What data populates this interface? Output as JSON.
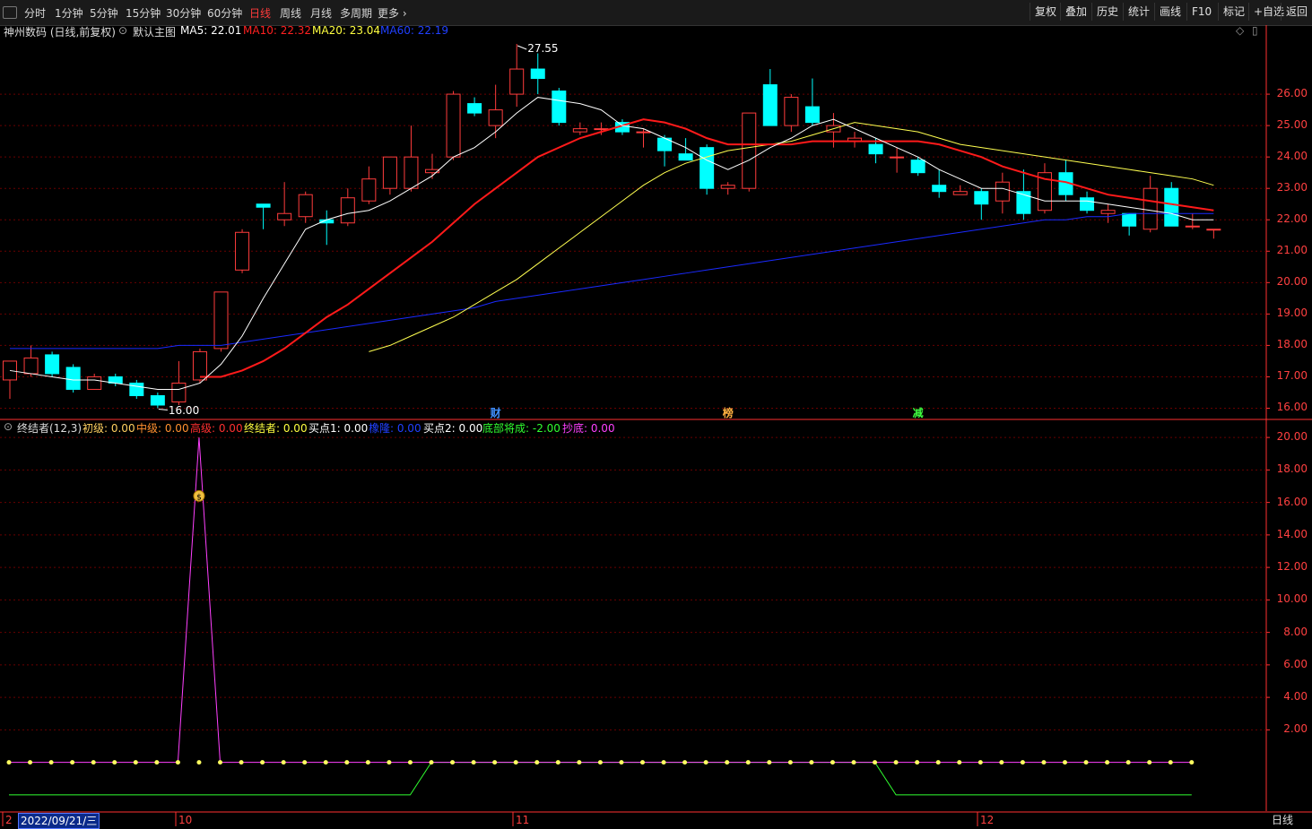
{
  "toolbar": {
    "periods": [
      "分时",
      "1分钟",
      "5分钟",
      "15分钟",
      "30分钟",
      "60分钟",
      "日线",
      "周线",
      "月线",
      "多周期",
      "更多 ›"
    ],
    "active_period": "日线",
    "right_buttons": [
      "复权",
      "叠加",
      "历史",
      "统计",
      "画线",
      "F10",
      "标记",
      "+自选",
      "返回"
    ]
  },
  "main_header": {
    "stock": "神州数码 (日线,前复权)",
    "template": "默认主图",
    "ma5": {
      "label": "MA5:",
      "value": "22.01",
      "color": "#ffffff"
    },
    "ma10": {
      "label": "MA10:",
      "value": "22.32",
      "color": "#ff2020"
    },
    "ma20": {
      "label": "MA20:",
      "value": "23.04",
      "color": "#ffff40"
    },
    "ma60": {
      "label": "MA60:",
      "value": "22.19",
      "color": "#2030ff"
    }
  },
  "sub_header": {
    "name": "终结者(12,3)",
    "items": [
      {
        "label": "初级:",
        "value": "0.00",
        "color": "#ffd060"
      },
      {
        "label": "中级:",
        "value": "0.00",
        "color": "#ff9030"
      },
      {
        "label": "高级:",
        "value": "0.00",
        "color": "#ff3030"
      },
      {
        "label": "终结者:",
        "value": "0.00",
        "color": "#ffff40"
      },
      {
        "label": "买点1:",
        "value": "0.00",
        "color": "#ffffff"
      },
      {
        "label": "橡隆:",
        "value": "0.00",
        "color": "#2040ff"
      },
      {
        "label": "买点2:",
        "value": "0.00",
        "color": "#ffffff"
      },
      {
        "label": "底部将成:",
        "value": "-2.00",
        "color": "#30ff30"
      },
      {
        "label": "抄底:",
        "value": "0.00",
        "color": "#ff40ff"
      }
    ]
  },
  "price_labels": {
    "high": "27.55",
    "low": "16.00"
  },
  "event_marks": [
    {
      "text": "财",
      "color": "#4090ff",
      "index": 23
    },
    {
      "text": "榜",
      "color": "#ffb040",
      "index": 34
    },
    {
      "text": "减",
      "color": "#40ff40",
      "index": 43
    }
  ],
  "x_axis": {
    "date_cursor": "2022/09/21/三",
    "month_labels": [
      "2",
      "10",
      "11",
      "12"
    ],
    "period_label": "日线"
  },
  "colors": {
    "up": "#ff3c3c",
    "down": "#00ffff",
    "ma5": "#ffffff",
    "ma10": "#ff1a1a",
    "ma20": "#ffff50",
    "ma60": "#1a2aff",
    "indicator": "#ff40ff",
    "bottom": "#30ff30",
    "axis": "#ff3030"
  },
  "chart_data": [
    {
      "type": "candlestick",
      "title": "神州数码 (日线,前复权)",
      "y_ticks": [
        16.0,
        17.0,
        18.0,
        19.0,
        20.0,
        21.0,
        22.0,
        23.0,
        24.0,
        25.0,
        26.0
      ],
      "ylim": [
        15.7,
        27.8
      ],
      "candles": [
        {
          "o": 16.9,
          "h": 17.5,
          "l": 16.3,
          "c": 17.5
        },
        {
          "o": 17.1,
          "h": 18.0,
          "l": 17.0,
          "c": 17.6
        },
        {
          "o": 17.7,
          "h": 17.8,
          "l": 17.0,
          "c": 17.1
        },
        {
          "o": 17.3,
          "h": 17.4,
          "l": 16.5,
          "c": 16.6
        },
        {
          "o": 16.6,
          "h": 17.1,
          "l": 16.6,
          "c": 17.0
        },
        {
          "o": 17.0,
          "h": 17.1,
          "l": 16.7,
          "c": 16.8
        },
        {
          "o": 16.8,
          "h": 16.9,
          "l": 16.3,
          "c": 16.4
        },
        {
          "o": 16.4,
          "h": 16.5,
          "l": 16.0,
          "c": 16.1
        },
        {
          "o": 16.2,
          "h": 17.5,
          "l": 16.1,
          "c": 16.8
        },
        {
          "o": 16.9,
          "h": 17.9,
          "l": 16.8,
          "c": 17.8
        },
        {
          "o": 17.9,
          "h": 19.7,
          "l": 17.8,
          "c": 19.7
        },
        {
          "o": 20.4,
          "h": 21.7,
          "l": 20.3,
          "c": 21.6
        },
        {
          "o": 22.5,
          "h": 22.5,
          "l": 21.7,
          "c": 22.4
        },
        {
          "o": 22.0,
          "h": 23.2,
          "l": 21.8,
          "c": 22.2
        },
        {
          "o": 22.1,
          "h": 22.9,
          "l": 21.9,
          "c": 22.8
        },
        {
          "o": 22.0,
          "h": 22.3,
          "l": 21.2,
          "c": 21.9
        },
        {
          "o": 21.9,
          "h": 23.0,
          "l": 21.8,
          "c": 22.7
        },
        {
          "o": 22.6,
          "h": 23.7,
          "l": 22.5,
          "c": 23.3
        },
        {
          "o": 23.0,
          "h": 24.0,
          "l": 22.8,
          "c": 24.0
        },
        {
          "o": 23.0,
          "h": 25.0,
          "l": 22.9,
          "c": 24.0
        },
        {
          "o": 23.5,
          "h": 24.1,
          "l": 23.3,
          "c": 23.6
        },
        {
          "o": 24.0,
          "h": 26.1,
          "l": 23.9,
          "c": 26.0
        },
        {
          "o": 25.7,
          "h": 25.9,
          "l": 25.3,
          "c": 25.4
        },
        {
          "o": 25.0,
          "h": 26.3,
          "l": 24.6,
          "c": 25.5
        },
        {
          "o": 26.0,
          "h": 27.6,
          "l": 25.6,
          "c": 26.8
        },
        {
          "o": 26.8,
          "h": 27.3,
          "l": 26.0,
          "c": 26.5
        },
        {
          "o": 26.1,
          "h": 26.2,
          "l": 25.0,
          "c": 25.1
        },
        {
          "o": 24.8,
          "h": 25.1,
          "l": 24.7,
          "c": 24.9
        },
        {
          "o": 24.9,
          "h": 25.1,
          "l": 24.7,
          "c": 24.9
        },
        {
          "o": 25.1,
          "h": 25.2,
          "l": 24.7,
          "c": 24.8
        },
        {
          "o": 24.8,
          "h": 24.9,
          "l": 24.3,
          "c": 24.8
        },
        {
          "o": 24.6,
          "h": 24.7,
          "l": 23.7,
          "c": 24.2
        },
        {
          "o": 24.1,
          "h": 24.6,
          "l": 23.9,
          "c": 23.9
        },
        {
          "o": 24.3,
          "h": 24.4,
          "l": 22.8,
          "c": 23.0
        },
        {
          "o": 23.0,
          "h": 23.2,
          "l": 22.8,
          "c": 23.1
        },
        {
          "o": 23.0,
          "h": 25.4,
          "l": 22.9,
          "c": 25.4
        },
        {
          "o": 26.3,
          "h": 26.8,
          "l": 25.0,
          "c": 25.0
        },
        {
          "o": 25.0,
          "h": 26.0,
          "l": 24.8,
          "c": 25.9
        },
        {
          "o": 25.6,
          "h": 26.5,
          "l": 25.0,
          "c": 25.1
        },
        {
          "o": 24.8,
          "h": 25.4,
          "l": 24.3,
          "c": 25.0
        },
        {
          "o": 24.5,
          "h": 24.8,
          "l": 24.3,
          "c": 24.6
        },
        {
          "o": 24.4,
          "h": 24.6,
          "l": 23.8,
          "c": 24.1
        },
        {
          "o": 24.0,
          "h": 24.3,
          "l": 23.5,
          "c": 24.0
        },
        {
          "o": 23.9,
          "h": 24.0,
          "l": 23.4,
          "c": 23.5
        },
        {
          "o": 23.1,
          "h": 23.6,
          "l": 22.7,
          "c": 22.9
        },
        {
          "o": 22.8,
          "h": 23.1,
          "l": 22.8,
          "c": 22.9
        },
        {
          "o": 22.9,
          "h": 23.0,
          "l": 22.0,
          "c": 22.5
        },
        {
          "o": 22.6,
          "h": 23.5,
          "l": 22.2,
          "c": 23.2
        },
        {
          "o": 22.9,
          "h": 23.6,
          "l": 22.0,
          "c": 22.2
        },
        {
          "o": 22.3,
          "h": 23.8,
          "l": 22.2,
          "c": 23.5
        },
        {
          "o": 23.5,
          "h": 23.9,
          "l": 22.6,
          "c": 22.8
        },
        {
          "o": 22.7,
          "h": 22.9,
          "l": 22.2,
          "c": 22.3
        },
        {
          "o": 22.2,
          "h": 22.5,
          "l": 21.9,
          "c": 22.3
        },
        {
          "o": 22.2,
          "h": 22.2,
          "l": 21.5,
          "c": 21.8
        },
        {
          "o": 21.7,
          "h": 23.4,
          "l": 21.6,
          "c": 23.0
        },
        {
          "o": 23.0,
          "h": 23.2,
          "l": 21.8,
          "c": 21.8
        },
        {
          "o": 21.8,
          "h": 22.2,
          "l": 21.7,
          "c": 21.8
        },
        {
          "o": 21.7,
          "h": 21.7,
          "l": 21.4,
          "c": 21.7
        }
      ],
      "ma5": [
        17.2,
        17.1,
        17.0,
        16.9,
        16.9,
        16.8,
        16.7,
        16.6,
        16.6,
        16.8,
        17.4,
        18.3,
        19.5,
        20.6,
        21.7,
        22.0,
        22.2,
        22.3,
        22.6,
        23.0,
        23.4,
        24.0,
        24.3,
        24.8,
        25.4,
        25.9,
        25.8,
        25.7,
        25.5,
        25.0,
        24.9,
        24.6,
        24.3,
        23.9,
        23.6,
        23.9,
        24.3,
        24.6,
        25.0,
        25.2,
        24.9,
        24.6,
        24.3,
        24.0,
        23.6,
        23.3,
        23.0,
        23.0,
        22.8,
        22.6,
        22.6,
        22.6,
        22.5,
        22.4,
        22.3,
        22.2,
        22.0,
        22.0
      ],
      "ma10": [
        null,
        null,
        null,
        null,
        null,
        null,
        null,
        null,
        null,
        17.0,
        17.0,
        17.2,
        17.5,
        17.9,
        18.4,
        18.9,
        19.3,
        19.8,
        20.3,
        20.8,
        21.3,
        21.9,
        22.5,
        23.0,
        23.5,
        24.0,
        24.3,
        24.6,
        24.8,
        25.0,
        25.2,
        25.1,
        24.9,
        24.6,
        24.4,
        24.4,
        24.4,
        24.4,
        24.5,
        24.5,
        24.5,
        24.5,
        24.5,
        24.5,
        24.4,
        24.2,
        24.0,
        23.7,
        23.5,
        23.3,
        23.2,
        23.0,
        22.8,
        22.7,
        22.6,
        22.5,
        22.4,
        22.3
      ],
      "ma20": [
        null,
        null,
        null,
        null,
        null,
        null,
        null,
        null,
        null,
        null,
        null,
        null,
        null,
        null,
        null,
        null,
        null,
        17.8,
        18.0,
        18.3,
        18.6,
        18.9,
        19.3,
        19.7,
        20.1,
        20.6,
        21.1,
        21.6,
        22.1,
        22.6,
        23.1,
        23.5,
        23.8,
        24.0,
        24.2,
        24.3,
        24.4,
        24.5,
        24.7,
        24.9,
        25.1,
        25.0,
        24.9,
        24.8,
        24.6,
        24.4,
        24.3,
        24.2,
        24.1,
        24.0,
        23.9,
        23.8,
        23.7,
        23.6,
        23.5,
        23.4,
        23.3,
        23.1
      ],
      "ma60": [
        17.9,
        17.9,
        17.9,
        17.9,
        17.9,
        17.9,
        17.9,
        17.9,
        18.0,
        18.0,
        18.0,
        18.1,
        18.2,
        18.3,
        18.4,
        18.5,
        18.6,
        18.7,
        18.8,
        18.9,
        19.0,
        19.1,
        19.2,
        19.4,
        19.5,
        19.6,
        19.7,
        19.8,
        19.9,
        20.0,
        20.1,
        20.2,
        20.3,
        20.4,
        20.5,
        20.6,
        20.7,
        20.8,
        20.9,
        21.0,
        21.1,
        21.2,
        21.3,
        21.4,
        21.5,
        21.6,
        21.7,
        21.8,
        21.9,
        22.0,
        22.0,
        22.1,
        22.1,
        22.2,
        22.2,
        22.2,
        22.2,
        22.2
      ]
    },
    {
      "type": "line",
      "title": "终结者(12,3)",
      "y_ticks": [
        2.0,
        4.0,
        6.0,
        8.0,
        10.0,
        12.0,
        14.0,
        16.0,
        18.0,
        20.0
      ],
      "ylim": [
        -3.0,
        21.0
      ],
      "series": [
        {
          "name": "抄底",
          "values": [
            0,
            0,
            0,
            0,
            0,
            0,
            0,
            0,
            0,
            20,
            0,
            0,
            0,
            0,
            0,
            0,
            0,
            0,
            0,
            0,
            0,
            0,
            0,
            0,
            0,
            0,
            0,
            0,
            0,
            0,
            0,
            0,
            0,
            0,
            0,
            0,
            0,
            0,
            0,
            0,
            0,
            0,
            0,
            0,
            0,
            0,
            0,
            0,
            0,
            0,
            0,
            0,
            0,
            0,
            0,
            0,
            0
          ]
        },
        {
          "name": "底部将成",
          "values": [
            -2,
            -2,
            -2,
            -2,
            -2,
            -2,
            -2,
            -2,
            -2,
            -2,
            -2,
            -2,
            -2,
            -2,
            -2,
            -2,
            -2,
            -2,
            -2,
            -2,
            0,
            0,
            0,
            0,
            0,
            0,
            0,
            0,
            0,
            0,
            0,
            0,
            0,
            0,
            0,
            0,
            0,
            0,
            0,
            0,
            0,
            0,
            -2,
            -2,
            -2,
            -2,
            -2,
            -2,
            -2,
            -2,
            -2,
            -2,
            -2,
            -2,
            -2,
            -2,
            -2
          ]
        }
      ],
      "signal_index": 9
    }
  ]
}
